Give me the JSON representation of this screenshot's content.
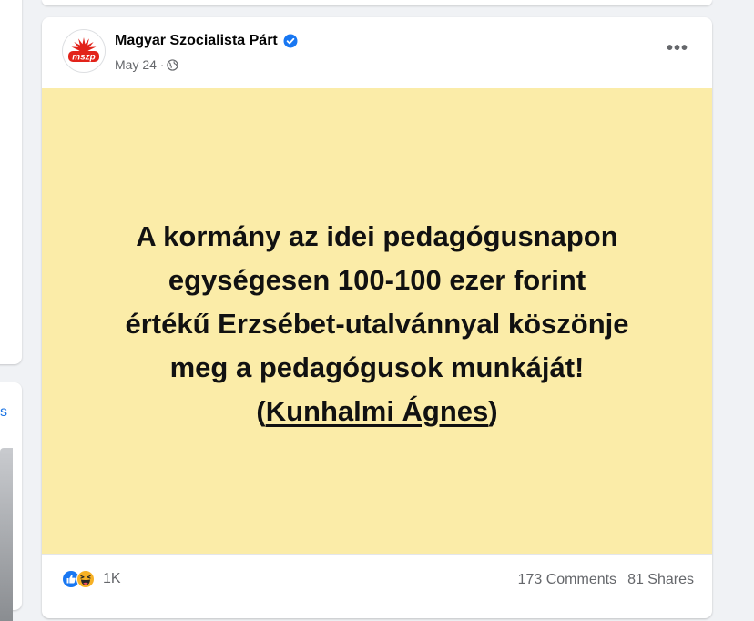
{
  "left_fragment": {
    "text": "s"
  },
  "post": {
    "author": "Magyar Szocialista Párt",
    "date": "May 24 ·",
    "logo_text": "mszp",
    "text_lines": [
      "A kormány az idei pedagógusnapon",
      "egységesen 100-100 ezer forint",
      "értékű Erzsébet-utalvánnyal köszönje",
      "meg a pedagógusok munkáját!"
    ],
    "attribution": {
      "open": "(",
      "name": "Kunhalmi Ágnes",
      "close": ")"
    },
    "background_color": "#fbeca8",
    "icons": {
      "more": "more-options-icon",
      "verified": "verified-badge-icon",
      "audience": "globe-icon",
      "reactions": [
        "like-reaction-icon",
        "haha-reaction-icon"
      ]
    }
  },
  "footer": {
    "reaction_count": "1K",
    "comments": "173 Comments",
    "shares": "81 Shares"
  },
  "colors": {
    "brand_red": "#e2231a",
    "facebook_blue": "#1877f2",
    "haha_yellow": "#f7b125"
  }
}
